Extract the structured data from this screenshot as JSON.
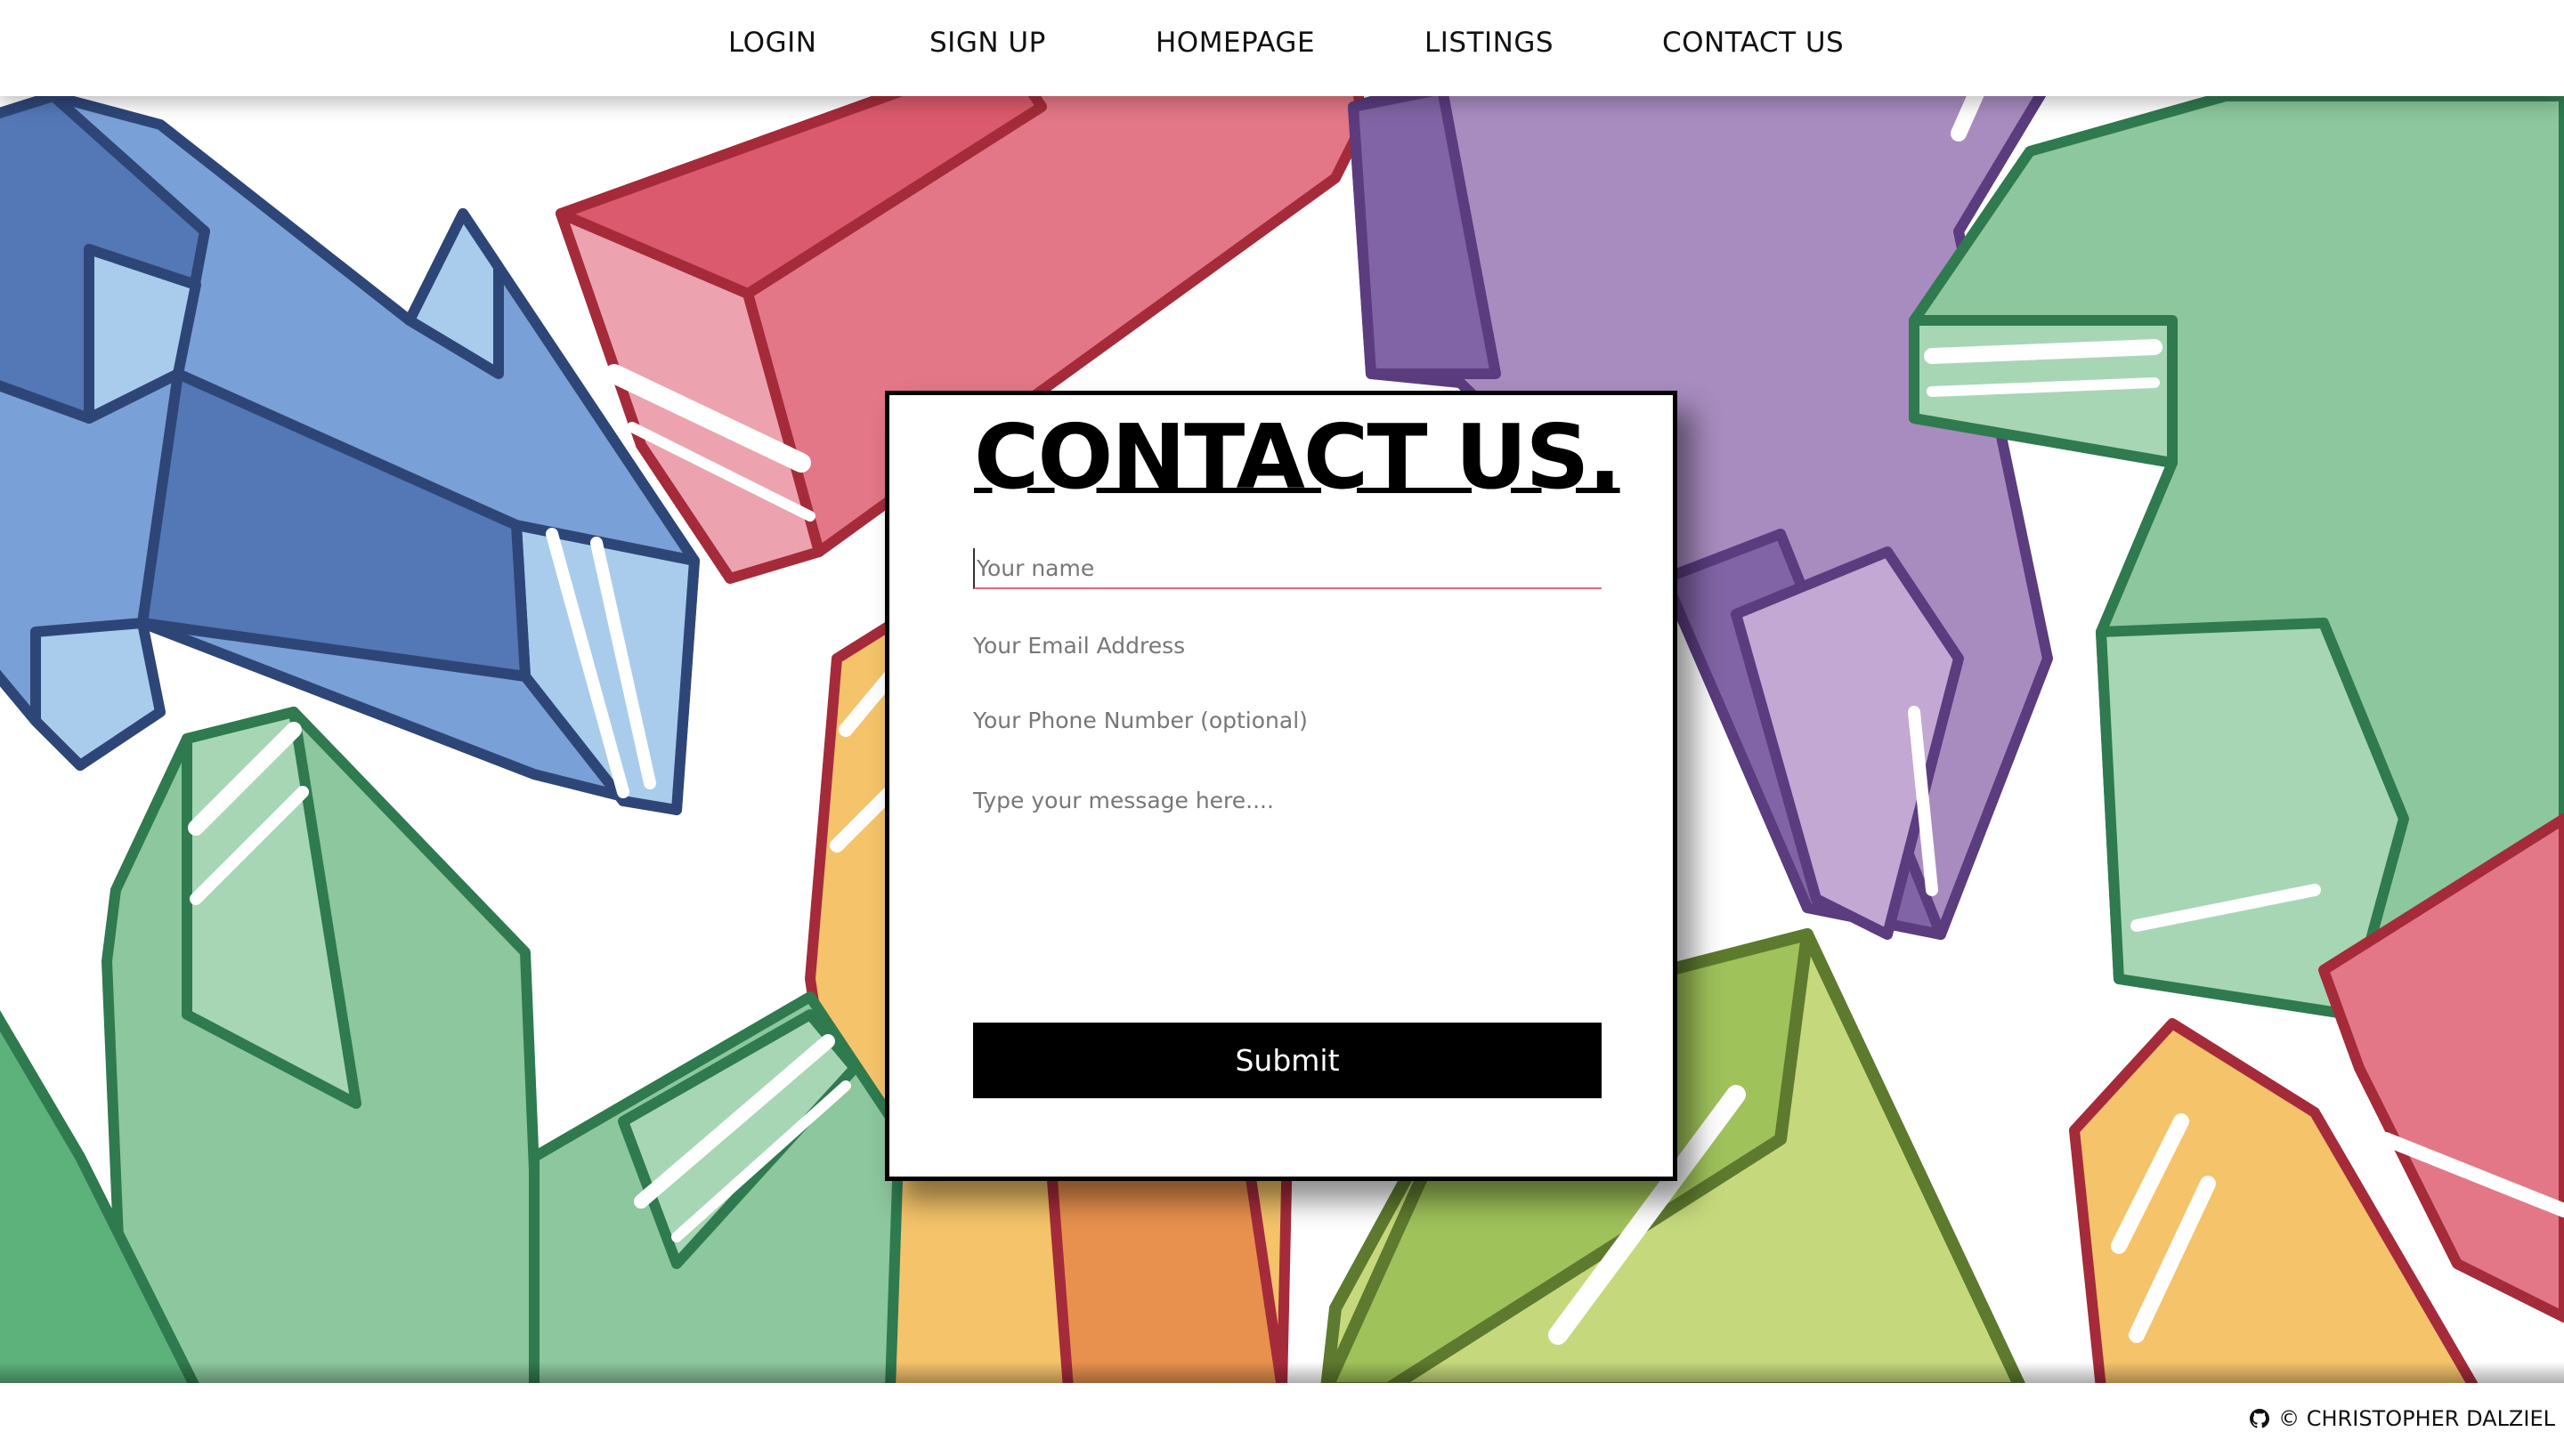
{
  "nav": {
    "items": [
      {
        "label": "LOGIN"
      },
      {
        "label": "SIGN UP"
      },
      {
        "label": "HOMEPAGE"
      },
      {
        "label": "LISTINGS"
      },
      {
        "label": "CONTACT US"
      }
    ]
  },
  "contact": {
    "title": "CONTACT US.",
    "name_placeholder": "Your name",
    "email_placeholder": "Your Email Address",
    "phone_placeholder": "Your Phone Number (optional)",
    "message_placeholder": "Type your message here....",
    "submit_label": "Submit"
  },
  "footer": {
    "credit": "© CHRISTOPHER DALZIEL"
  },
  "colors": {
    "accent_underline": "#e06b78",
    "button_bg": "#000000",
    "button_text": "#ffffff"
  }
}
